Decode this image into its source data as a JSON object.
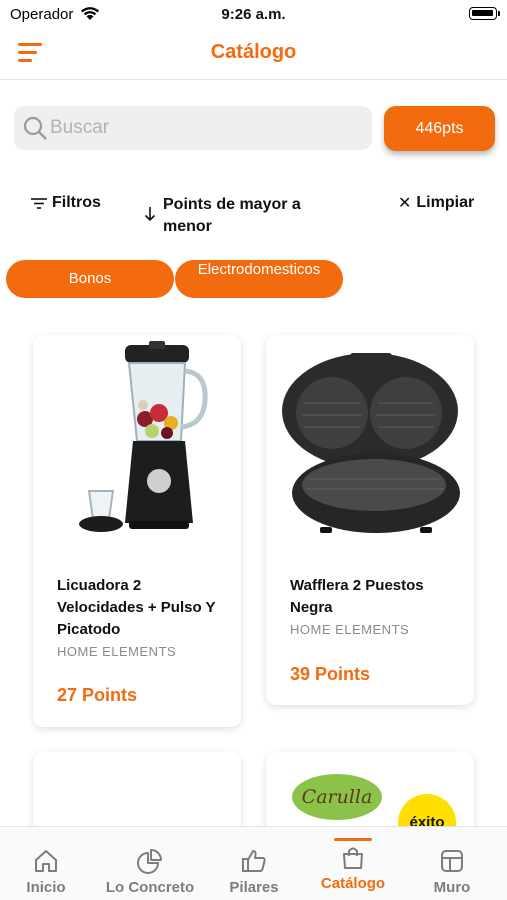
{
  "status_bar": {
    "carrier": "Operador",
    "time": "9:26 a.m."
  },
  "header": {
    "title": "Catálogo",
    "menu_icon": "hamburger-menu-icon"
  },
  "search": {
    "placeholder": "Buscar",
    "value": "",
    "icon": "search-icon"
  },
  "points_badge": "446pts",
  "filters": {
    "filters_label": "Filtros",
    "sort_label": "Points de mayor a menor",
    "clear_label": "Limpiar"
  },
  "categories": [
    {
      "label": "Bonos"
    },
    {
      "label": "Electrodomesticos"
    }
  ],
  "products": [
    {
      "name": "Licuadora 2 Velocidades + Pulso Y Picatodo",
      "brand": "HOME ELEMENTS",
      "points": "27 Points"
    },
    {
      "name": "Wafflera 2 Puestos Negra",
      "brand": "HOME ELEMENTS",
      "points": "39 Points"
    }
  ],
  "partner_logos": {
    "carulla": "Carulla",
    "exito": "éxito"
  },
  "tabs": [
    {
      "label": "Inicio",
      "icon": "home-icon"
    },
    {
      "label": "Lo Concreto",
      "icon": "pie-chart-icon"
    },
    {
      "label": "Pilares",
      "icon": "thumbs-up-icon"
    },
    {
      "label": "Catálogo",
      "icon": "shopping-bag-icon",
      "active": true
    },
    {
      "label": "Muro",
      "icon": "layout-icon"
    }
  ],
  "colors": {
    "accent": "#f26b0f",
    "inactive_tab": "#7d7d7d",
    "search_bg": "#efefef"
  }
}
